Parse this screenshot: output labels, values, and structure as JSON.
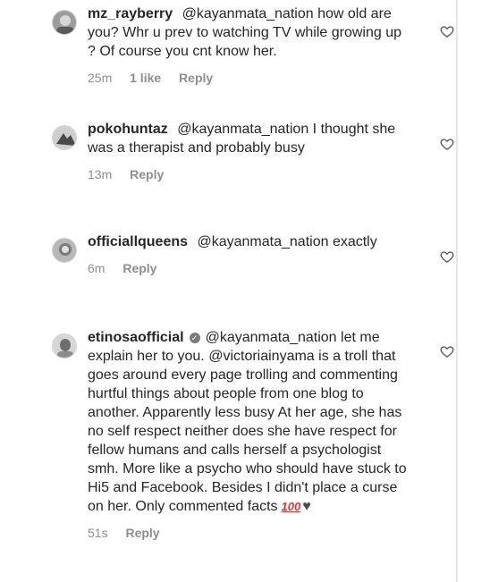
{
  "comments": [
    {
      "username": "mz_rayberry",
      "mention": "@kayanmata_nation",
      "text": "how old are you? Whr u prev to watching TV while growing up ? Of course you cnt know her.",
      "time": "25m",
      "likes": "1 like",
      "reply": "Reply",
      "avatar_icon": "avatar-icon"
    },
    {
      "username": "pokohuntaz",
      "mention": "@kayanmata_nation",
      "text": "I thought she was a therapist and probably busy",
      "time": "13m",
      "reply": "Reply",
      "avatar_icon": "avatar-icon"
    },
    {
      "username": "officiallqueens",
      "mention": "@kayanmata_nation",
      "text": "exactly",
      "time": "6m",
      "reply": "Reply",
      "avatar_icon": "avatar-icon"
    },
    {
      "username": "etinosaofficial",
      "verified_icon": "verified-icon",
      "mention": "@kayanmata_nation",
      "text_before": "let me explain her to you.",
      "mention2": "@victoriainyama",
      "text_after": "is a troll that goes around every page trolling and commenting hurtful things about people from one blog to another. Apparently less busy At her age, she has no self respect neither does she have respect for fellow humans and calls herself a psychologist smh. More like a psycho who should have stuck to Hi5 and Facebook. Besides I didn't place a curse on her. Only commented facts",
      "emoji1": "100",
      "emoji2": "♥",
      "time": "51s",
      "reply": "Reply",
      "avatar_icon": "avatar-icon"
    }
  ],
  "icons": {
    "like": "heart-outline-icon",
    "verified_glyph": "✓"
  }
}
